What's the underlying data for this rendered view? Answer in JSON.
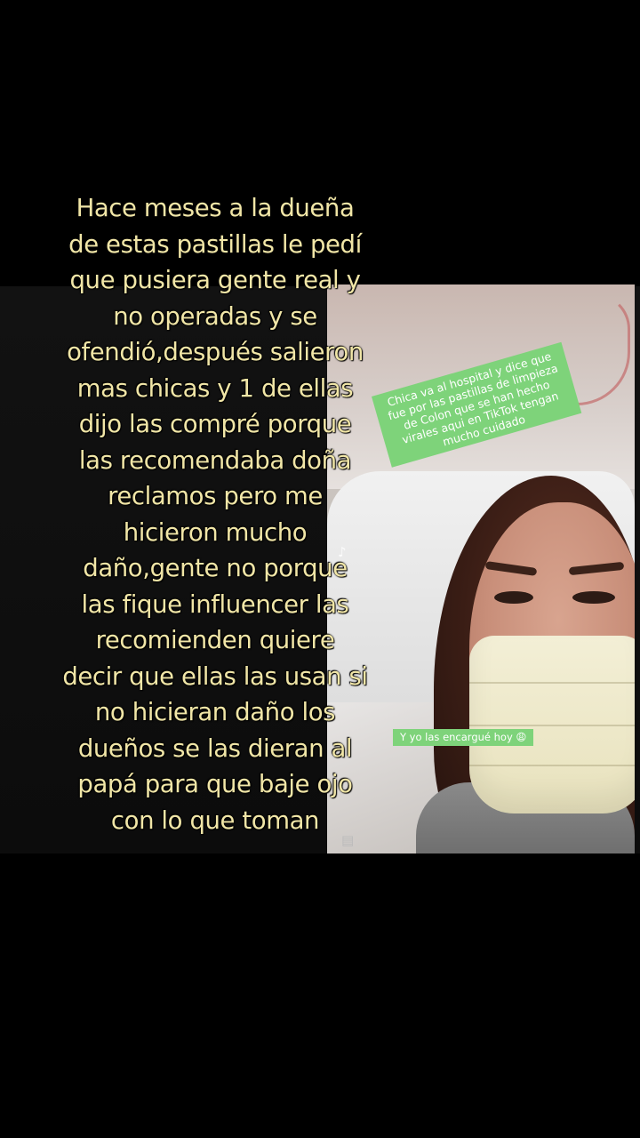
{
  "overlay_text": {
    "lines": [
      "Hace meses a la dueña",
      "de estas pastillas le pedí",
      "que pusiera gente real y",
      "no operadas y se",
      "ofendió,después salieron",
      "mas chicas y 1 de ellas",
      "dijo las compré porque",
      "las recomendaba doña",
      "reclamos pero me",
      "hicieron mucho",
      "daño,gente no porque",
      "las fique influencer las",
      "recomienden quiere",
      "decir que ellas las usan si",
      "no hicieran daño los",
      "dueños se las dieran al",
      "papá para que baje ojo",
      "con lo que toman"
    ],
    "color": "#f1e6a7"
  },
  "photo": {
    "green_note": "Chica va al hospital y dice que fue por las pastillas de limpieza de Colon que se han hecho virales aqui en TikTok tengan mucho cuidado",
    "green_note_2": "Y yo las encargué hoy 😩",
    "note_color": "#7ed37a"
  },
  "icons": {
    "tiktok": "tiktok-logo-icon",
    "doc": "document-icon"
  }
}
